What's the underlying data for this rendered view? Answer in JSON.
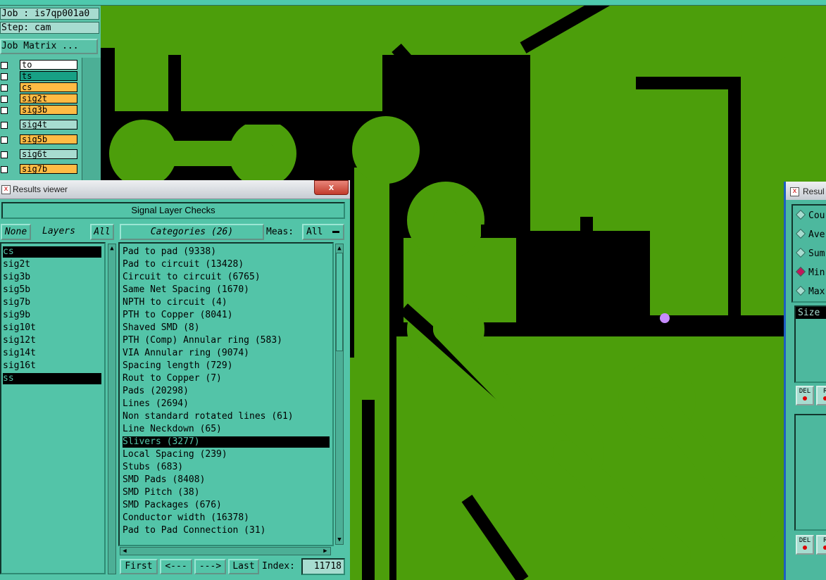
{
  "job_panel": {
    "job_field": "Job : is7qp001a0",
    "step_field": "Step: cam",
    "matrix_button": "Job Matrix ...",
    "layers": [
      {
        "name": "to",
        "color": "#ffffff"
      },
      {
        "name": "ts",
        "color": "#17a085"
      },
      {
        "name": "cs",
        "color": "#ffbb44"
      },
      {
        "name": "sig2t",
        "color": "#ffbb44"
      },
      {
        "name": "sig3b",
        "color": "#ffbb44"
      },
      {
        "name": "sig4t",
        "color": "#a7dcd0"
      },
      {
        "name": "sig5b",
        "color": "#ffbb44"
      },
      {
        "name": "sig6t",
        "color": "#a7dcd0"
      },
      {
        "name": "sig7b",
        "color": "#ffbb44"
      }
    ]
  },
  "results_viewer": {
    "window_title": "Results viewer",
    "close_glyph": "x",
    "heading": "Signal Layer Checks",
    "none_button": "None",
    "layers_label": "Layers",
    "all_button": "All",
    "categories_label": "Categories (26)",
    "meas_label": "Meas:",
    "meas_value": "All",
    "layer_list": [
      "cs",
      "sig2t",
      "sig3b",
      "sig5b",
      "sig7b",
      "sig9b",
      "sig10t",
      "sig12t",
      "sig14t",
      "sig16t",
      "ss"
    ],
    "selected_layers": [
      "cs",
      "ss"
    ],
    "categories": [
      "Pad to pad (9338)",
      "Pad to circuit (13428)",
      "Circuit to circuit (6765)",
      "Same Net Spacing (1670)",
      "NPTH to circuit (4)",
      "PTH to Copper (8041)",
      "Shaved SMD (8)",
      "PTH (Comp) Annular ring (583)",
      "VIA Annular ring (9074)",
      "Spacing length (729)",
      "Rout to Copper (7)",
      "Pads (20298)",
      "Lines (2694)",
      "Non standard rotated lines (61)",
      "Line Neckdown (65)",
      "Slivers (3277)",
      "Local Spacing (239)",
      "Stubs (683)",
      "SMD Pads (8408)",
      "SMD Pitch (38)",
      "SMD Packages (676)",
      "Conductor width (16378)",
      "Pad to Pad Connection (31)"
    ],
    "selected_category": "Slivers (3277)",
    "nav": {
      "first": "First",
      "prev": "<---",
      "next": "--->",
      "last": "Last",
      "index_label": "Index:",
      "index_value": "11718"
    }
  },
  "right_panel": {
    "title": "Resul",
    "options": [
      {
        "label": "Cou",
        "selected": false
      },
      {
        "label": "Ave",
        "selected": false
      },
      {
        "label": "Sum",
        "selected": false
      },
      {
        "label": "Min",
        "selected": true
      },
      {
        "label": "Max",
        "selected": false
      }
    ],
    "size_header": "Size",
    "del_label": "DEL",
    "r_label": "R"
  },
  "colors": {
    "copper": "#4c9e0b",
    "background": "#000000",
    "panel": "#53c4a8",
    "highlight": "#000000",
    "measure_marker": "#c78cff"
  }
}
